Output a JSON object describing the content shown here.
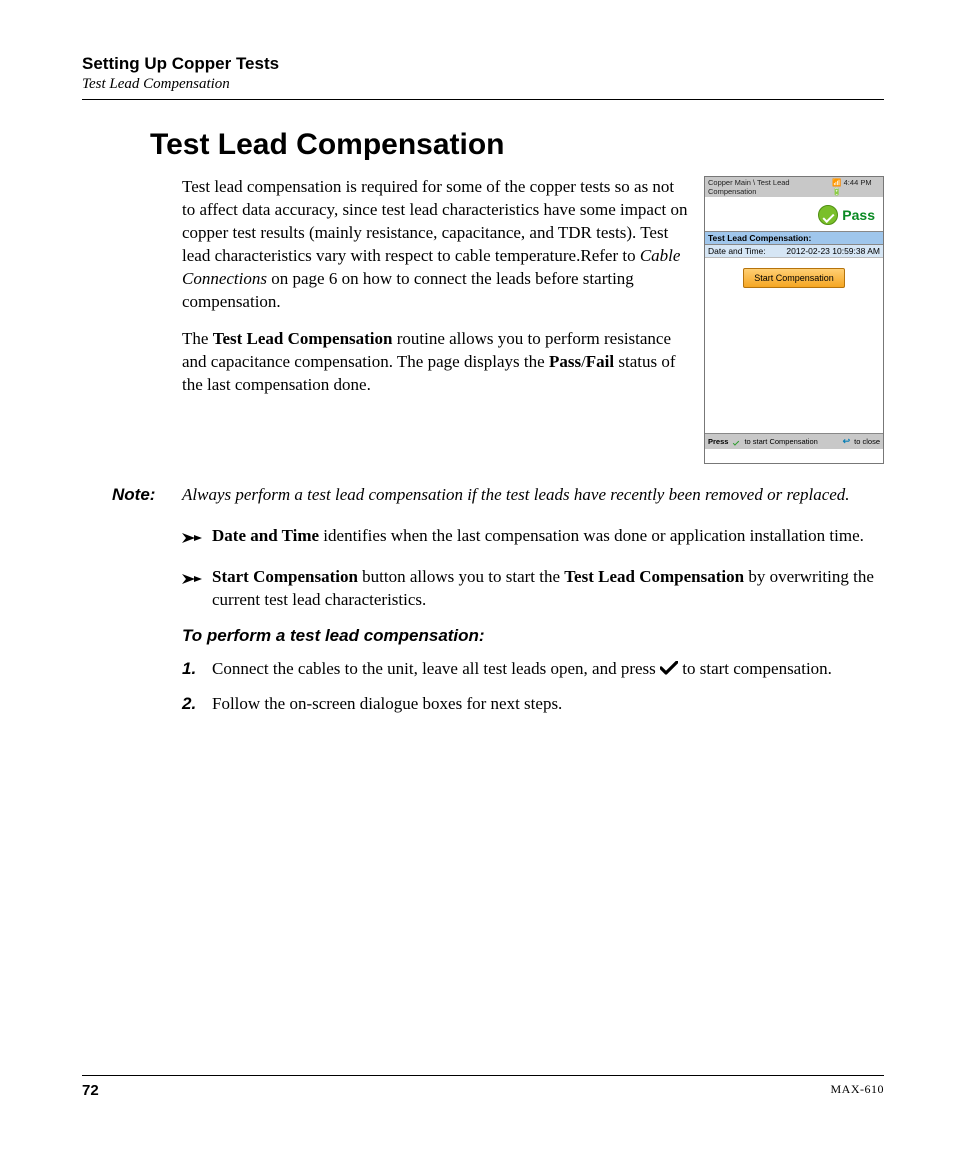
{
  "header": {
    "chapter": "Setting Up Copper Tests",
    "section": "Test Lead Compensation"
  },
  "heading": "Test Lead Compensation",
  "intro": {
    "p1_a": "Test lead compensation is required for some of the copper tests so as not to affect data accuracy, since test lead characteristics have some impact on copper test results (mainly resistance, capacitance, and TDR tests). Test lead characteristics vary with respect to cable temperature.Refer to ",
    "p1_ital": "Cable Connections",
    "p1_b": " on page 6 on how to connect the leads before starting compensation.",
    "p2_a": "The ",
    "p2_bold1": "Test Lead Compensation",
    "p2_b": " routine allows you to perform resistance and capacitance compensation. The page displays the ",
    "p2_bold2": "Pass",
    "p2_slash": "/",
    "p2_bold3": "Fail",
    "p2_c": " status of the last compensation done."
  },
  "note": {
    "label": "Note:",
    "text": "Always perform a test lead compensation if the test leads have recently been removed or replaced."
  },
  "bullets": [
    {
      "bold": "Date and Time",
      "rest": " identifies when the last compensation was done or application installation time."
    },
    {
      "bold": "Start Compensation",
      "mid": " button allows you to start the ",
      "bold2": "Test Lead Compensation",
      "rest": " by overwriting the current test lead characteristics."
    }
  ],
  "procedure": {
    "heading": "To perform a test lead compensation:",
    "steps": [
      {
        "num": "1.",
        "a": "Connect the cables to the unit, leave all test leads open, and press ",
        "b": " to start compensation."
      },
      {
        "num": "2.",
        "a": "Follow the on-screen dialogue boxes for next steps."
      }
    ]
  },
  "device": {
    "breadcrumb": "Copper Main \\ Test Lead Compensation",
    "clock": "4:44 PM",
    "status": "Pass",
    "sectionHeader": "Test Lead Compensation:",
    "row_label": "Date and Time:",
    "row_value": "2012-02-23 10:59:38 AM",
    "button": "Start Compensation",
    "footer_press": "Press",
    "footer_start": "to start Compensation",
    "footer_close": "to close"
  },
  "footer": {
    "page": "72",
    "model": "MAX-610"
  }
}
